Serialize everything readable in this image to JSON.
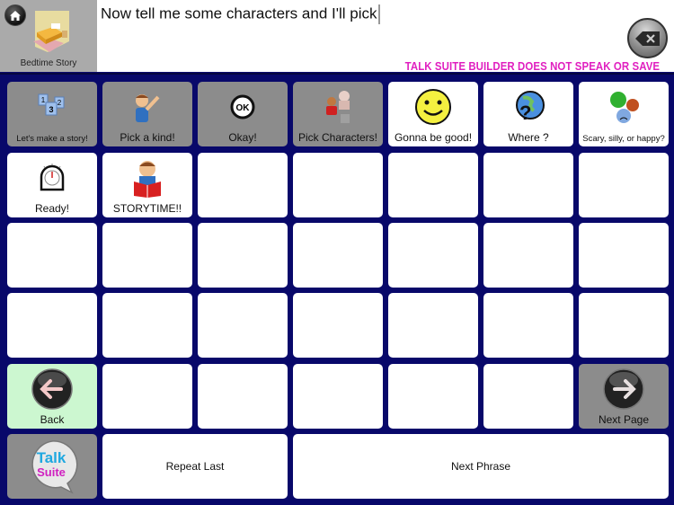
{
  "header": {
    "board_label": "Bedtime Story",
    "message": "Now tell me some characters and I'll pick",
    "warning": "TALK SUITE BUILDER DOES NOT SPEAK OR SAVE",
    "home_icon": "home-icon",
    "clear_icon": "backspace-clear-icon"
  },
  "colors": {
    "grid_background": "#08086a",
    "warning_text": "#e020c0",
    "gray_cell": "#8c8c8c",
    "back_cell": "#ccf7d0"
  },
  "cells": {
    "r1": [
      {
        "label": "Let's make a story!",
        "icon": "numbered-steps-icon"
      },
      {
        "label": "Pick a kind!",
        "icon": "boy-pointing-icon"
      },
      {
        "label": "Okay!",
        "icon": "ok-icon"
      },
      {
        "label": "Pick Characters!",
        "icon": "characters-icon"
      },
      {
        "label": "Gonna be good!",
        "icon": "smiley-face-icon"
      },
      {
        "label": "Where ?",
        "icon": "globe-question-icon"
      },
      {
        "label": "Scary, silly, or happy?",
        "icon": "emotion-faces-icon"
      }
    ],
    "r2": [
      {
        "label": "Ready!",
        "icon": "timer-icon"
      },
      {
        "label": "STORYTIME!!",
        "icon": "boy-reading-icon"
      }
    ],
    "nav": {
      "back": "Back",
      "next_page": "Next Page",
      "repeat_last": "Repeat Last",
      "next_phrase": "Next Phrase",
      "logo_top": "Talk",
      "logo_bottom": "Suite"
    }
  }
}
